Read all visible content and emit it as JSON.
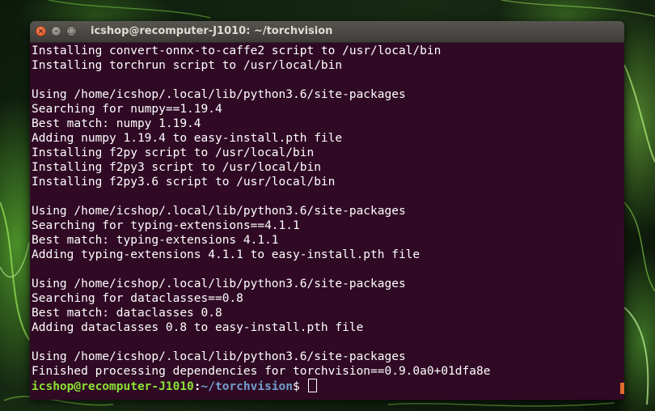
{
  "window": {
    "title": "icshop@recomputer-J1010: ~/torchvision",
    "buttons": {
      "close": "×",
      "minimize": "–",
      "maximize": "□"
    }
  },
  "terminal": {
    "lines": [
      "Installing convert-onnx-to-caffe2 script to /usr/local/bin",
      "Installing torchrun script to /usr/local/bin",
      "",
      "Using /home/icshop/.local/lib/python3.6/site-packages",
      "Searching for numpy==1.19.4",
      "Best match: numpy 1.19.4",
      "Adding numpy 1.19.4 to easy-install.pth file",
      "Installing f2py script to /usr/local/bin",
      "Installing f2py3 script to /usr/local/bin",
      "Installing f2py3.6 script to /usr/local/bin",
      "",
      "Using /home/icshop/.local/lib/python3.6/site-packages",
      "Searching for typing-extensions==4.1.1",
      "Best match: typing-extensions 4.1.1",
      "Adding typing-extensions 4.1.1 to easy-install.pth file",
      "",
      "Using /home/icshop/.local/lib/python3.6/site-packages",
      "Searching for dataclasses==0.8",
      "Best match: dataclasses 0.8",
      "Adding dataclasses 0.8 to easy-install.pth file",
      "",
      "Using /home/icshop/.local/lib/python3.6/site-packages",
      "Finished processing dependencies for torchvision==0.9.0a0+01dfa8e"
    ],
    "prompt": {
      "user_host": "icshop@recomputer-J1010",
      "separator": ":",
      "path": "~/torchvision",
      "symbol": "$ "
    }
  },
  "colors": {
    "terminal_bg": "#300a24",
    "text": "#ffffff",
    "prompt_user": "#8ae234",
    "prompt_path": "#729fcf",
    "close_button": "#df4a16",
    "scroll_indicator": "#e06b2d"
  }
}
